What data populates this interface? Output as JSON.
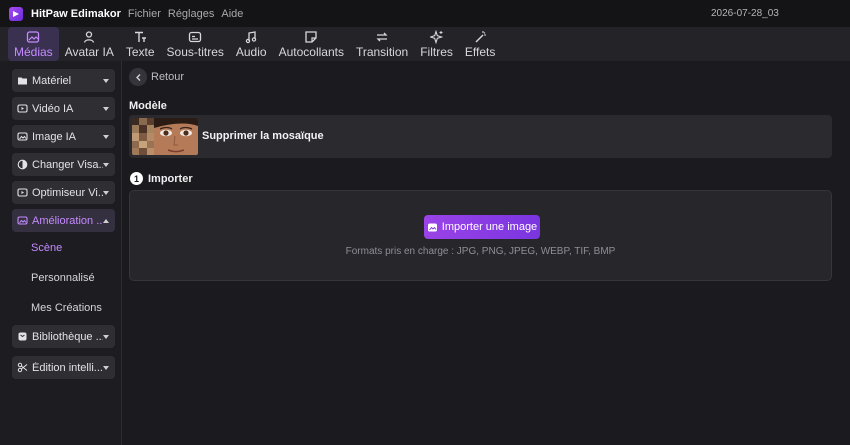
{
  "app": {
    "title": "HitPaw Edimakor",
    "menu": [
      "Fichier",
      "Réglages",
      "Aide"
    ],
    "timestamp": "2026-07-28_03"
  },
  "toolbar": {
    "tabs": [
      {
        "label": "Médias",
        "icon": "image-icon",
        "active": true
      },
      {
        "label": "Avatar IA",
        "icon": "avatar-icon",
        "active": false
      },
      {
        "label": "Texte",
        "icon": "text-icon",
        "active": false
      },
      {
        "label": "Sous-titres",
        "icon": "subtitles-icon",
        "active": false
      },
      {
        "label": "Audio",
        "icon": "music-icon",
        "active": false
      },
      {
        "label": "Autocollants",
        "icon": "sticker-icon",
        "active": false
      },
      {
        "label": "Transition",
        "icon": "transition-icon",
        "active": false
      },
      {
        "label": "Filtres",
        "icon": "sparkle-icon",
        "active": false
      },
      {
        "label": "Effets",
        "icon": "magic-wand-icon",
        "active": false
      }
    ]
  },
  "sidebar": {
    "items": [
      {
        "label": "Matériel",
        "icon": "folder-icon"
      },
      {
        "label": "Vidéo IA",
        "icon": "video-ai-icon"
      },
      {
        "label": "Image IA",
        "icon": "image-ai-icon"
      },
      {
        "label": "Changer Visa...",
        "icon": "face-swap-icon"
      },
      {
        "label": "Optimiseur Vi...",
        "icon": "optimizer-icon"
      },
      {
        "label": "Amélioration ...",
        "icon": "enhance-icon",
        "expanded": true
      },
      {
        "label": "Bibliothèque ...",
        "icon": "library-icon"
      },
      {
        "label": "Édition intelli...",
        "icon": "scissors-icon"
      }
    ],
    "subitems": [
      {
        "label": "Scène",
        "active": true
      },
      {
        "label": "Personnalisé",
        "active": false
      },
      {
        "label": "Mes Créations",
        "active": false
      }
    ]
  },
  "main": {
    "back_label": "Retour",
    "model_section": "Modèle",
    "model_name": "Supprimer la mosaïque",
    "import_step": "1",
    "import_section": "Importer",
    "import_button": "Importer une image",
    "formats": "Formats pris en charge : JPG, PNG, JPEG, WEBP, TIF, BMP"
  },
  "colors": {
    "accent": "#c58bff",
    "button_gradient_start": "#9a43e8",
    "button_gradient_end": "#7a35e0",
    "background": "#1b1b1f"
  }
}
